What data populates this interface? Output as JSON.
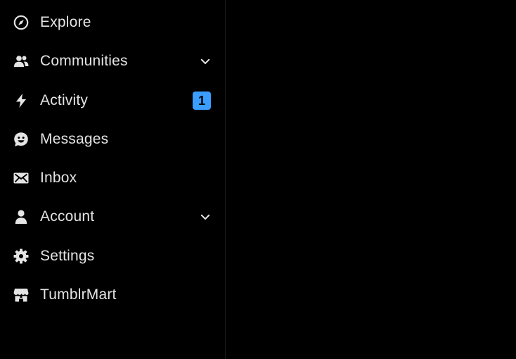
{
  "sidebar": {
    "items": [
      {
        "label": "Explore",
        "icon": "compass-icon"
      },
      {
        "label": "Communities",
        "icon": "people-icon",
        "expandable": true
      },
      {
        "label": "Activity",
        "icon": "lightning-icon",
        "badge": "1"
      },
      {
        "label": "Messages",
        "icon": "smiley-bubble-icon"
      },
      {
        "label": "Inbox",
        "icon": "envelope-icon"
      },
      {
        "label": "Account",
        "icon": "person-icon",
        "expandable": true
      },
      {
        "label": "Settings",
        "icon": "gear-icon"
      },
      {
        "label": "TumblrMart",
        "icon": "storefront-icon"
      }
    ]
  },
  "content": {
    "emoji": "😭"
  },
  "colors": {
    "background": "#000000",
    "text": "#e4e4e4",
    "icon": "#e4e4e4",
    "badge": "#3b9dff"
  }
}
